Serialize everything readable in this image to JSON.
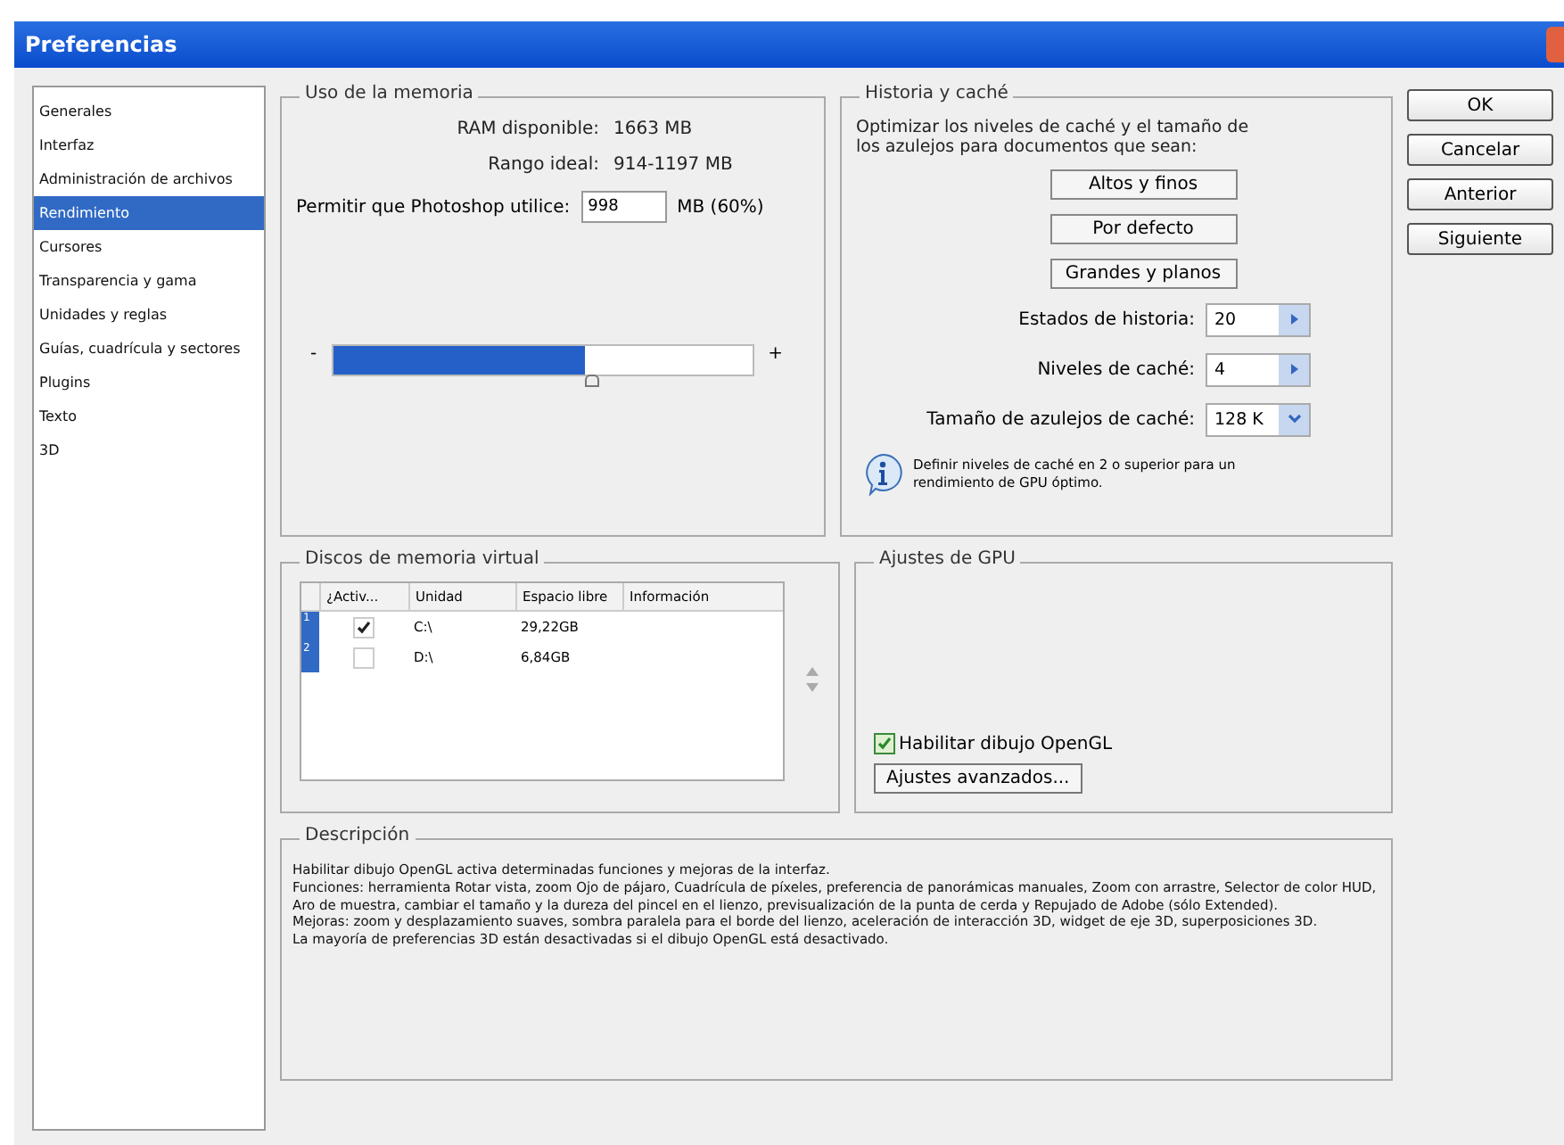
{
  "window": {
    "title": "Preferencias"
  },
  "sidebar": {
    "items": [
      {
        "label": "Generales",
        "selected": false
      },
      {
        "label": "Interfaz",
        "selected": false
      },
      {
        "label": "Administración de archivos",
        "selected": false
      },
      {
        "label": "Rendimiento",
        "selected": true
      },
      {
        "label": "Cursores",
        "selected": false
      },
      {
        "label": "Transparencia y gama",
        "selected": false
      },
      {
        "label": "Unidades y reglas",
        "selected": false
      },
      {
        "label": "Guías, cuadrícula y sectores",
        "selected": false
      },
      {
        "label": "Plugins",
        "selected": false
      },
      {
        "label": "Texto",
        "selected": false
      },
      {
        "label": "3D",
        "selected": false
      }
    ]
  },
  "memory": {
    "title": "Uso de la memoria",
    "rows": [
      {
        "label": "RAM disponible:",
        "value": "1663 MB"
      },
      {
        "label": "Rango ideal:",
        "value": "914-1197 MB"
      }
    ],
    "allow_label": "Permitir que Photoshop utilice:",
    "allow_value": "998",
    "allow_unit": "MB (60%)",
    "slider": {
      "minus": "-",
      "plus": "+",
      "level": 0.6
    }
  },
  "history": {
    "title": "Historia y caché",
    "intro": "Optimizar los niveles de caché y el tamaño de los azulejos para documentos que sean:",
    "presets": [
      "Altos y finos",
      "Por defecto",
      "Grandes y planos"
    ],
    "fields": [
      {
        "kind": "spinner",
        "label": "Estados de historia:",
        "value": "20"
      },
      {
        "kind": "spinner",
        "label": "Niveles de caché:",
        "value": "4"
      },
      {
        "kind": "dropdown",
        "label": "Tamaño de azulejos de caché:",
        "value": "128 K"
      }
    ],
    "note": "Definir niveles de caché en 2 o superior para un rendimiento de GPU óptimo."
  },
  "buttons": [
    "OK",
    "Cancelar",
    "Anterior",
    "Siguiente"
  ],
  "disks": {
    "title": "Discos de memoria virtual",
    "columns": [
      "¿Activ...",
      "Unidad",
      "Espacio libre",
      "Información"
    ],
    "rows": [
      {
        "index": "1",
        "checked": true,
        "drive": "C:\\",
        "free": "29,22GB",
        "selected": true
      },
      {
        "index": "2",
        "checked": false,
        "drive": "D:\\",
        "free": "6,84GB",
        "selected": true
      }
    ]
  },
  "gpu": {
    "title": "Ajustes de GPU",
    "opengl": {
      "label": "Habilitar dibujo OpenGL",
      "checked": true
    },
    "advanced": "Ajustes avanzados..."
  },
  "description": {
    "title": "Descripción",
    "paragraphs": [
      "Habilitar dibujo OpenGL activa determinadas funciones y mejoras de la interfaz.",
      "Funciones: herramienta Rotar vista, zoom Ojo de pájaro, Cuadrícula de píxeles, preferencia de panorámicas manuales, Zoom con arrastre, Selector de color HUD, Aro de muestra, cambiar el tamaño y la dureza del pincel en el lienzo, previsualización de la punta de cerda y Repujado de Adobe (sólo Extended).",
      "Mejoras: zoom y desplazamiento suaves, sombra paralela para el borde del lienzo, aceleración de interacción 3D, widget de eje 3D, superposiciones 3D.",
      "La mayoría de preferencias 3D están desactivadas si el dibujo OpenGL está desactivado."
    ]
  }
}
